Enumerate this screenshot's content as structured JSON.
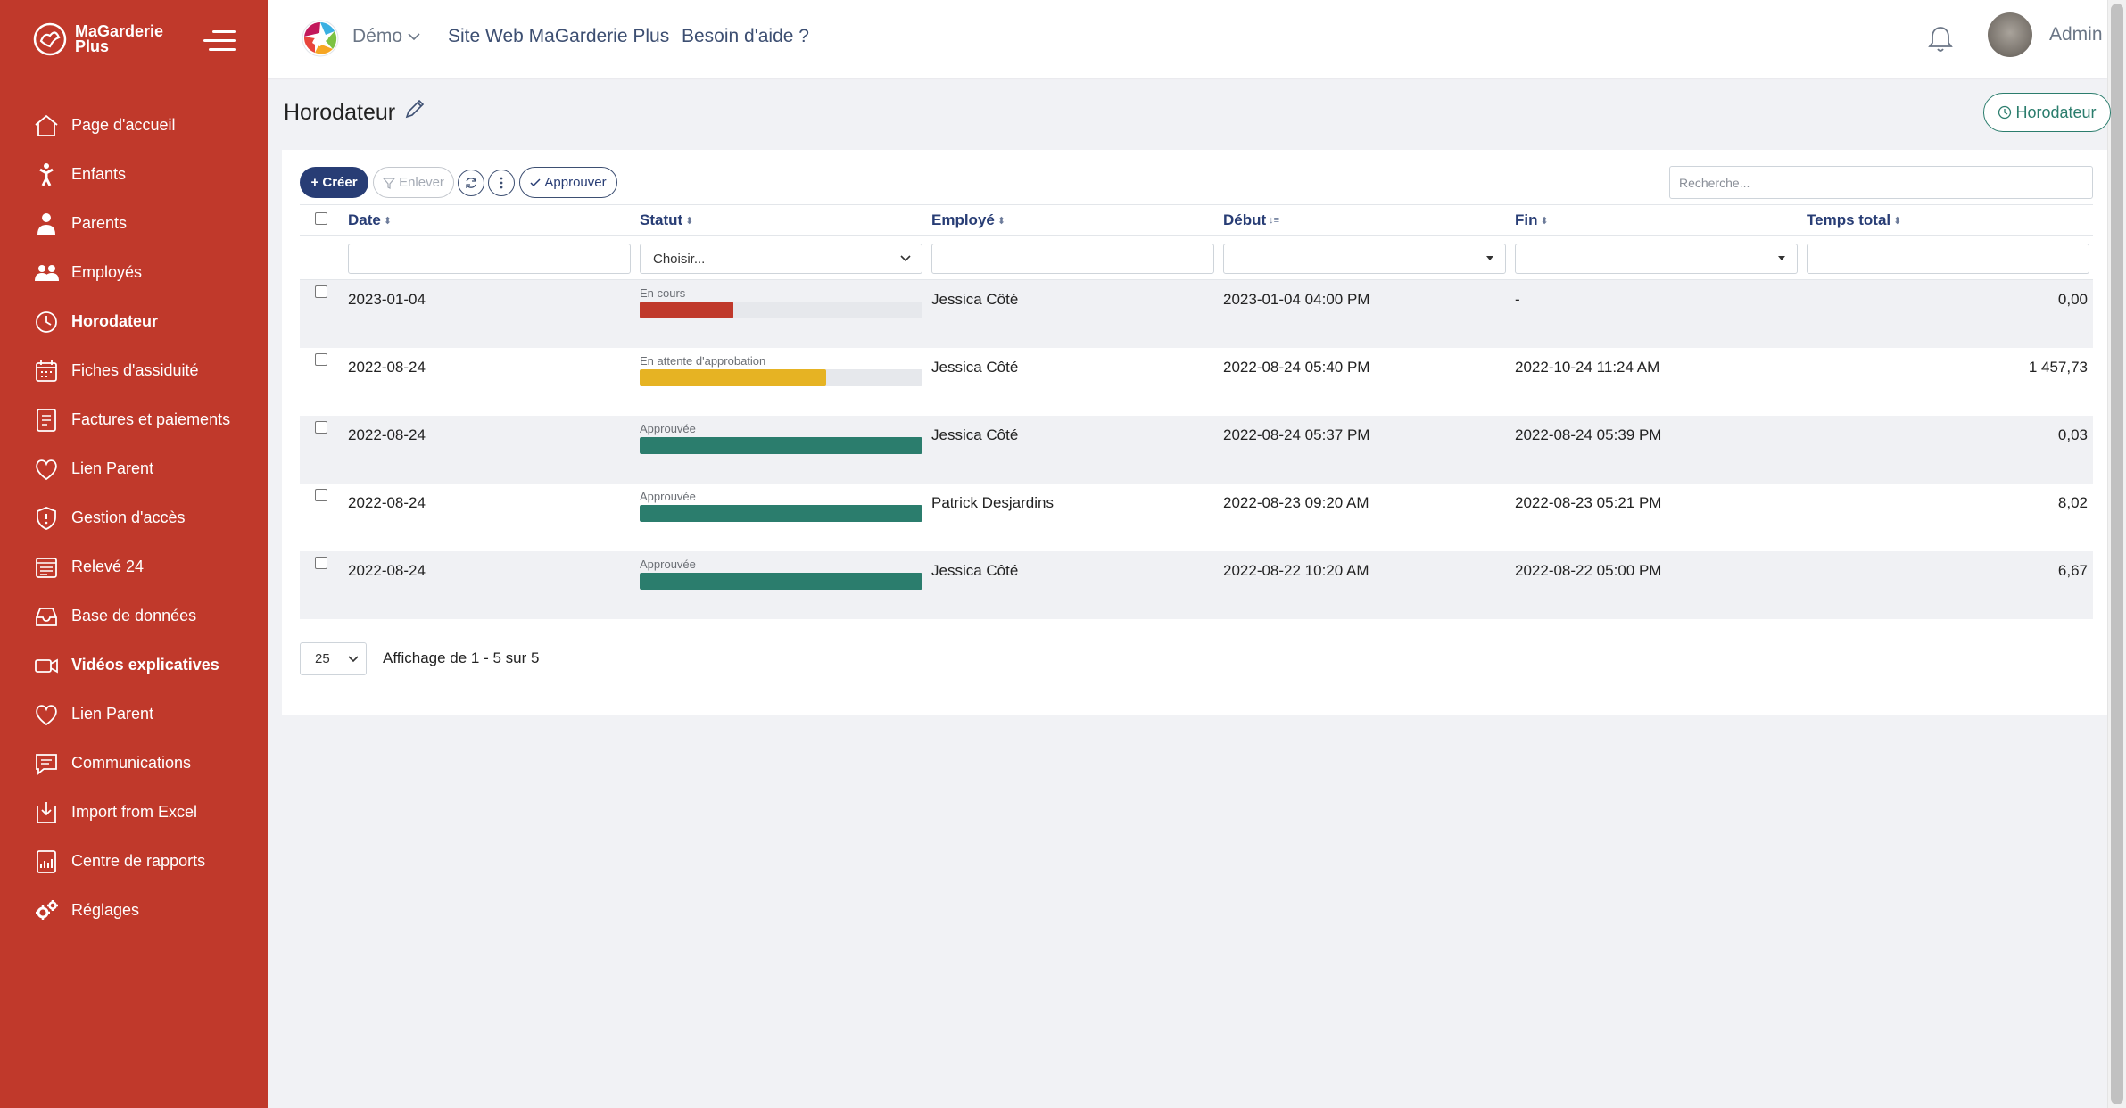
{
  "sidebar": {
    "brand": "MaGarderie Plus",
    "items": [
      {
        "label": "Page d'accueil",
        "icon": "home-icon",
        "bold": false
      },
      {
        "label": "Enfants",
        "icon": "child-icon",
        "bold": false
      },
      {
        "label": "Parents",
        "icon": "parent-icon",
        "bold": false
      },
      {
        "label": "Employés",
        "icon": "employees-icon",
        "bold": false
      },
      {
        "label": "Horodateur",
        "icon": "clock-icon",
        "bold": true
      },
      {
        "label": "Fiches d'assiduité",
        "icon": "calendar-icon",
        "bold": false
      },
      {
        "label": "Factures et paiements",
        "icon": "invoice-icon",
        "bold": false
      },
      {
        "label": "Lien Parent",
        "icon": "heart-icon",
        "bold": false
      },
      {
        "label": "Gestion d'accès",
        "icon": "shield-icon",
        "bold": false
      },
      {
        "label": "Relevé 24",
        "icon": "report-calendar-icon",
        "bold": false
      },
      {
        "label": "Base de données",
        "icon": "inbox-icon",
        "bold": false
      },
      {
        "label": "Vidéos explicatives",
        "icon": "video-icon",
        "bold": true
      },
      {
        "label": "Lien Parent",
        "icon": "heart-icon",
        "bold": false
      },
      {
        "label": "Communications",
        "icon": "message-icon",
        "bold": false
      },
      {
        "label": "Import from Excel",
        "icon": "import-icon",
        "bold": false
      },
      {
        "label": "Centre de rapports",
        "icon": "reports-icon",
        "bold": false
      },
      {
        "label": "Réglages",
        "icon": "gears-icon",
        "bold": false
      }
    ]
  },
  "topbar": {
    "demo": "Démo",
    "site_link": "Site Web MaGarderie Plus",
    "help_link": "Besoin d'aide ?",
    "user": "Admin"
  },
  "page": {
    "title": "Horodateur",
    "header_button": "Horodateur"
  },
  "toolbar": {
    "create": "+ Créer",
    "remove": "Enlever",
    "approve": "Approuver",
    "search_placeholder": "Recherche..."
  },
  "table": {
    "columns": [
      "Date",
      "Statut",
      "Employé",
      "Début",
      "Fin",
      "Temps total"
    ],
    "status_filter": "Choisir...",
    "rows": [
      {
        "date": "2023-01-04",
        "status": "En cours",
        "progress": 0.33,
        "color": "#c0392b",
        "employee": "Jessica Côté",
        "start": "2023-01-04 04:00 PM",
        "end": "-",
        "total": "0,00"
      },
      {
        "date": "2022-08-24",
        "status": "En attente d'approbation",
        "progress": 0.66,
        "color": "#e6b323",
        "employee": "Jessica Côté",
        "start": "2022-08-24 05:40 PM",
        "end": "2022-10-24 11:24 AM",
        "total": "1 457,73"
      },
      {
        "date": "2022-08-24",
        "status": "Approuvée",
        "progress": 1.0,
        "color": "#2b7d6d",
        "employee": "Jessica Côté",
        "start": "2022-08-24 05:37 PM",
        "end": "2022-08-24 05:39 PM",
        "total": "0,03"
      },
      {
        "date": "2022-08-24",
        "status": "Approuvée",
        "progress": 1.0,
        "color": "#2b7d6d",
        "employee": "Patrick Desjardins",
        "start": "2022-08-23 09:20 AM",
        "end": "2022-08-23 05:21 PM",
        "total": "8,02"
      },
      {
        "date": "2022-08-24",
        "status": "Approuvée",
        "progress": 1.0,
        "color": "#2b7d6d",
        "employee": "Jessica Côté",
        "start": "2022-08-22 10:20 AM",
        "end": "2022-08-22 05:00 PM",
        "total": "6,67"
      }
    ]
  },
  "pager": {
    "size": "25",
    "info": "Affichage de 1 - 5 sur 5"
  },
  "colors": {
    "sidebar": "#c0392b",
    "primary": "#283d75",
    "accent": "#2b7d6d"
  }
}
